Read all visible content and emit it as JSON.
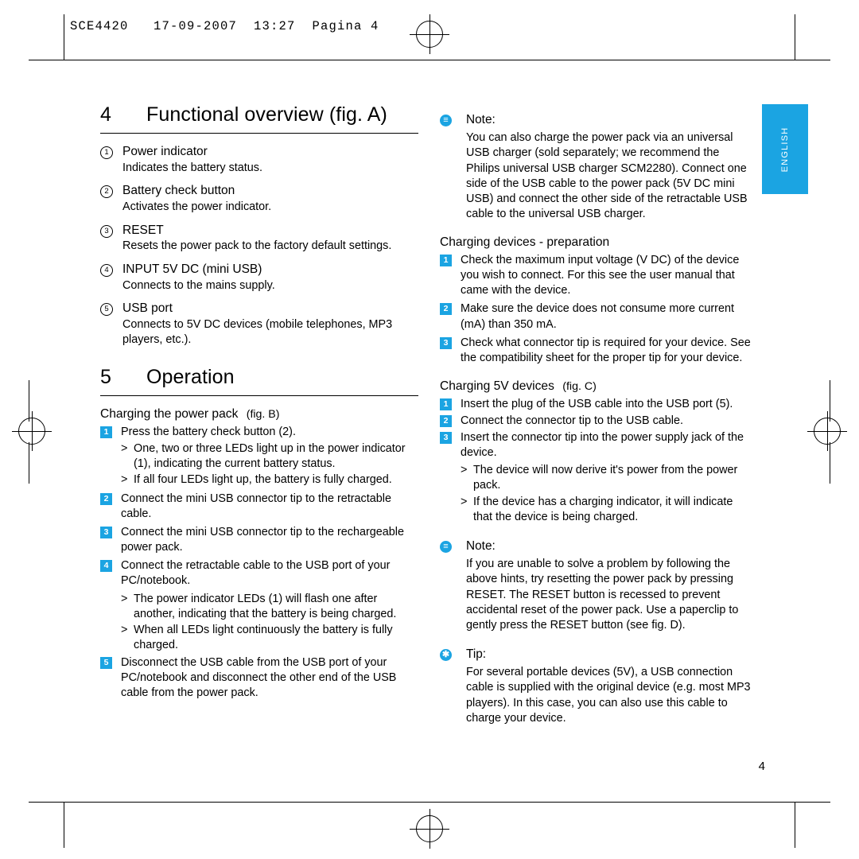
{
  "header": {
    "slug": "SCE4420   17-09-2007  13:27  Pagina 4"
  },
  "lang_tab": {
    "label": "ENGLISH",
    "color": "#1ba4e2"
  },
  "folio": "4",
  "left_column": {
    "section4": {
      "number": "4",
      "title": "Functional overview (fig. A)",
      "items": [
        {
          "marker": "1",
          "title": "Power indicator",
          "desc": "Indicates the battery status."
        },
        {
          "marker": "2",
          "title": "Battery check button",
          "desc": "Activates the power indicator."
        },
        {
          "marker": "3",
          "title": "RESET",
          "desc": "Resets the power pack to the factory default settings."
        },
        {
          "marker": "4",
          "title": "INPUT 5V DC (mini USB)",
          "desc": "Connects to the mains supply."
        },
        {
          "marker": "5",
          "title": "USB port",
          "desc": "Connects to 5V DC devices (mobile telephones, MP3 players, etc.)."
        }
      ]
    },
    "section5": {
      "number": "5",
      "title": "Operation",
      "subhead": "Charging the power pack",
      "subhead_fig": "(fig. B)",
      "steps": [
        {
          "marker": "1",
          "text": "Press the battery check button (2)."
        },
        {
          "marker": ">",
          "text": "One, two or three LEDs light up in the power indicator (1), indicating the current battery status."
        },
        {
          "marker": ">",
          "text": "If all four LEDs light up, the battery is fully charged."
        },
        {
          "marker": "2",
          "text": "Connect the mini USB connector tip to the retractable cable."
        },
        {
          "marker": "3",
          "text": "Connect the mini USB connector tip to the rechargeable power pack."
        },
        {
          "marker": "4",
          "text": "Connect the retractable cable to the USB port of your PC/notebook."
        },
        {
          "marker": ">",
          "text": "The power indicator LEDs (1) will flash one after another, indicating that the battery is being charged."
        },
        {
          "marker": ">",
          "text": "When all LEDs light continuously the battery is fully charged."
        },
        {
          "marker": "5",
          "text": "Disconnect the USB cable from the USB port of your PC/notebook and disconnect the other end of the USB cable from the power pack."
        }
      ]
    }
  },
  "right_column": {
    "note1": {
      "icon": "note-icon",
      "title": "Note:",
      "body": "You can also charge the power pack via an universal USB charger (sold separately; we recommend the Philips universal USB charger SCM2280). Connect one side of the USB cable to the power pack (5V DC mini USB) and connect the other side of the retractable USB cable to the universal USB charger."
    },
    "prep": {
      "subhead": "Charging devices - preparation",
      "steps": [
        {
          "marker": "1",
          "text": "Check the maximum input voltage (V DC) of the device you wish to connect. For this see the user manual that came with the device."
        },
        {
          "marker": "2",
          "text": "Make sure the device does not consume more current (mA) than 350 mA."
        },
        {
          "marker": "3",
          "text": "Check what connector tip is required for your device. See the compatibility sheet for the proper tip for your device."
        }
      ]
    },
    "charging5v": {
      "subhead": "Charging 5V devices",
      "subhead_fig": "(fig. C)",
      "steps": [
        {
          "marker": "1",
          "text": "Insert the plug of the USB cable into the USB port (5)."
        },
        {
          "marker": "2",
          "text": "Connect the connector tip to the USB cable."
        },
        {
          "marker": "3",
          "text": "Insert the connector tip into the power supply jack of the device."
        },
        {
          "marker": ">",
          "text": "The device will now derive it's power from the power pack."
        },
        {
          "marker": ">",
          "text": "If the device has a charging indicator, it will indicate that the device is being charged."
        }
      ]
    },
    "note2": {
      "icon": "note-icon",
      "title": "Note:",
      "body": "If you are unable to solve a problem by following the above hints, try resetting the power pack by pressing RESET. The RESET button is recessed to prevent accidental reset of the power pack. Use a paperclip to gently press the RESET button (see fig. D)."
    },
    "tip": {
      "icon": "tip-icon",
      "title": "Tip:",
      "body": "For several portable devices (5V), a USB connection cable is supplied with the original device (e.g. most MP3 players). In this case, you can also use this cable to charge your device."
    }
  }
}
